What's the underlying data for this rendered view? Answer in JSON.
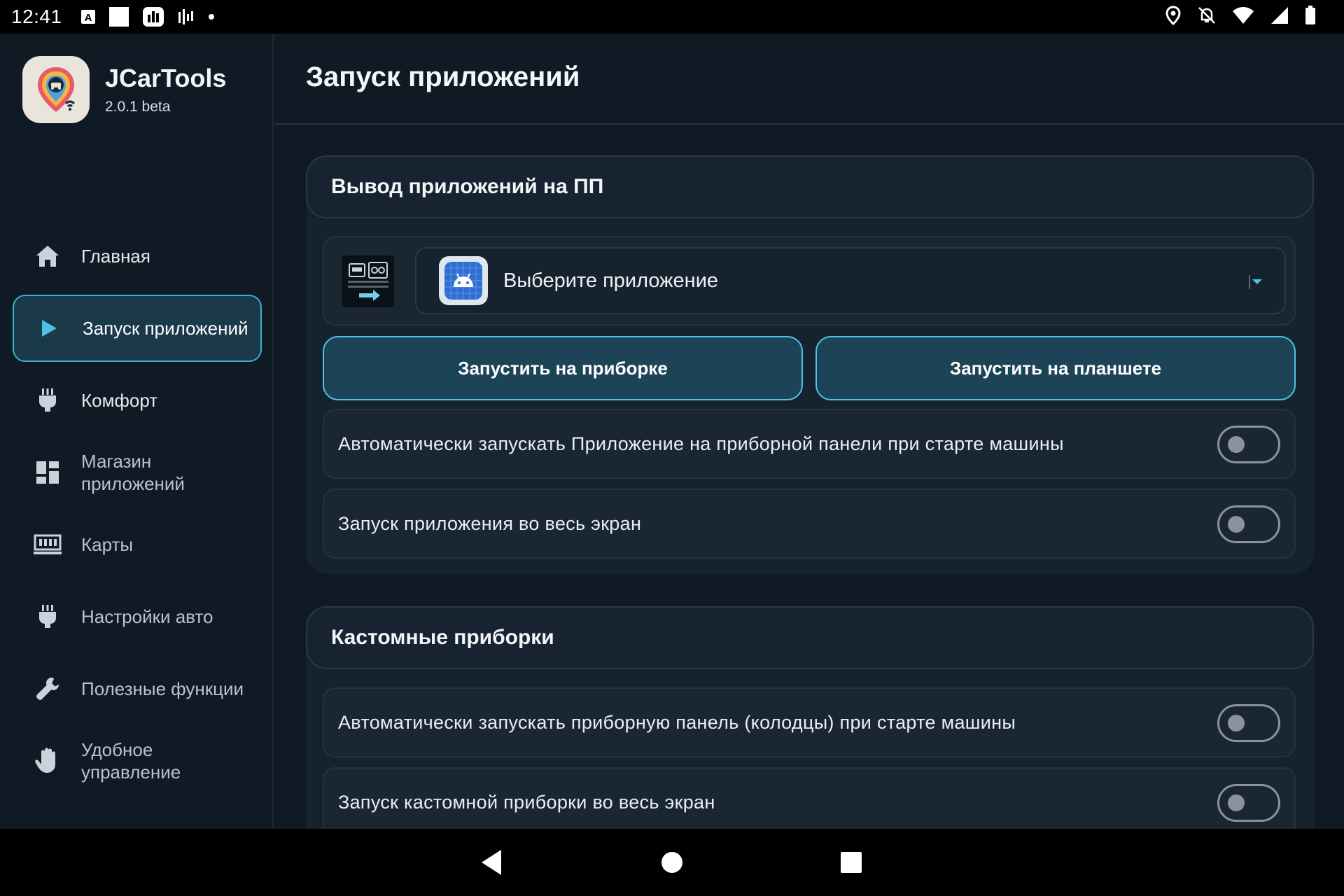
{
  "status_bar": {
    "time": "12:41",
    "left_icons": [
      "keyboard-a-icon",
      "white-square-icon",
      "app-badge-icon",
      "sound-bars-icon",
      "dot-icon"
    ],
    "right_icons": [
      "location-icon",
      "notifications-off-icon",
      "wifi-icon",
      "signal-icon",
      "battery-icon"
    ]
  },
  "sidebar": {
    "app_name": "JCarTools",
    "app_version": "2.0.1 beta",
    "items": [
      {
        "label": "Главная",
        "icon": "home-icon",
        "active": false
      },
      {
        "label": "Запуск приложений",
        "icon": "play-icon",
        "active": true
      },
      {
        "label": "Комфорт",
        "icon": "plug-icon",
        "active": false
      },
      {
        "label": "Магазин приложений",
        "icon": "dashboard-grid-icon",
        "active": false
      },
      {
        "label": "Карты",
        "icon": "map-icon",
        "active": false
      },
      {
        "label": "Настройки авто",
        "icon": "plug-icon",
        "active": false
      },
      {
        "label": "Полезные функции",
        "icon": "wrench-icon",
        "active": false
      },
      {
        "label": "Удобное управление",
        "icon": "hand-icon",
        "active": false
      }
    ]
  },
  "main": {
    "title": "Запуск приложений",
    "section_apps": {
      "header": "Вывод приложений на ПП",
      "select_placeholder": "Выберите приложение",
      "btn_cluster": "Запустить на приборке",
      "btn_tablet": "Запустить на планшете",
      "toggles": [
        {
          "label": "Автоматически запускать Приложение на приборной панели при старте машины",
          "on": false
        },
        {
          "label": "Запуск приложения во весь экран",
          "on": false
        }
      ]
    },
    "section_custom": {
      "header": "Кастомные приборки",
      "toggles": [
        {
          "label": "Автоматически запускать приборную панель (колодцы) при старте машины",
          "on": false
        },
        {
          "label": "Запуск кастомной приборки во весь экран",
          "on": false
        }
      ]
    }
  },
  "navigation_bar": {
    "buttons": [
      "back-icon",
      "home-circle-icon",
      "recents-icon"
    ]
  },
  "colors": {
    "background": "#101a25",
    "card": "#16222e",
    "accent": "#3bb0cf",
    "button_fill": "#1c4456"
  }
}
